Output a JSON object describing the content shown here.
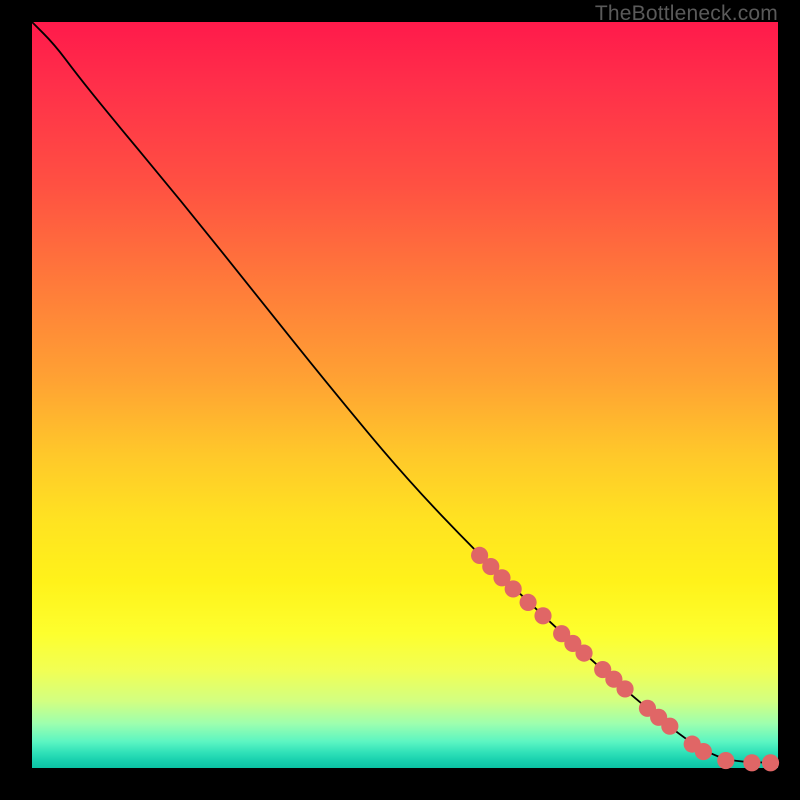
{
  "watermark": "TheBottleneck.com",
  "chart_data": {
    "type": "line",
    "title": "",
    "xlabel": "",
    "ylabel": "",
    "xlim": [
      0,
      100
    ],
    "ylim": [
      0,
      100
    ],
    "grid": false,
    "series": [
      {
        "name": "curve",
        "color": "#000000",
        "points": [
          {
            "x": 0,
            "y": 100
          },
          {
            "x": 3,
            "y": 97
          },
          {
            "x": 6,
            "y": 93
          },
          {
            "x": 10,
            "y": 88
          },
          {
            "x": 20,
            "y": 76
          },
          {
            "x": 30,
            "y": 63.5
          },
          {
            "x": 40,
            "y": 51
          },
          {
            "x": 50,
            "y": 39
          },
          {
            "x": 60,
            "y": 28.5
          },
          {
            "x": 70,
            "y": 19
          },
          {
            "x": 80,
            "y": 10
          },
          {
            "x": 88,
            "y": 3.5
          },
          {
            "x": 92,
            "y": 1.4
          },
          {
            "x": 95,
            "y": 0.8
          },
          {
            "x": 100,
            "y": 0.7
          }
        ]
      }
    ],
    "markers": {
      "name": "highlighted-points",
      "color": "#e06666",
      "radius_pct": 1.15,
      "points": [
        {
          "x": 60.0,
          "y": 28.5
        },
        {
          "x": 61.5,
          "y": 27.0
        },
        {
          "x": 63.0,
          "y": 25.5
        },
        {
          "x": 64.5,
          "y": 24.0
        },
        {
          "x": 66.5,
          "y": 22.2
        },
        {
          "x": 68.5,
          "y": 20.4
        },
        {
          "x": 71.0,
          "y": 18.0
        },
        {
          "x": 72.5,
          "y": 16.7
        },
        {
          "x": 74.0,
          "y": 15.4
        },
        {
          "x": 76.5,
          "y": 13.2
        },
        {
          "x": 78.0,
          "y": 11.9
        },
        {
          "x": 79.5,
          "y": 10.6
        },
        {
          "x": 82.5,
          "y": 8.0
        },
        {
          "x": 84.0,
          "y": 6.8
        },
        {
          "x": 85.5,
          "y": 5.6
        },
        {
          "x": 88.5,
          "y": 3.2
        },
        {
          "x": 90.0,
          "y": 2.2
        },
        {
          "x": 93.0,
          "y": 1.0
        },
        {
          "x": 96.5,
          "y": 0.7
        },
        {
          "x": 99.0,
          "y": 0.7
        }
      ]
    }
  }
}
